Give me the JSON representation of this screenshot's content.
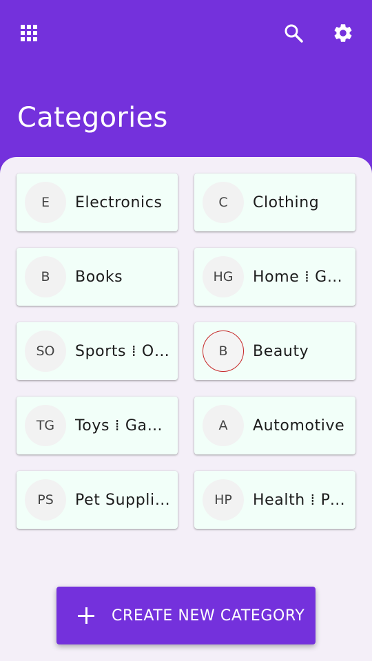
{
  "app": {
    "title": "Categories"
  },
  "toolbar": {
    "menu_icon": "apps-grid-icon",
    "search_icon": "search-icon",
    "settings_icon": "gear-icon"
  },
  "categories": [
    {
      "initials": "E",
      "name": "Electronics"
    },
    {
      "initials": "C",
      "name": "Clothing"
    },
    {
      "initials": "B",
      "name": "Books"
    },
    {
      "initials": "HG",
      "name": "Home ⁞ Ga…"
    },
    {
      "initials": "SO",
      "name": "Sports ⁞ O…"
    },
    {
      "initials": "B",
      "name": "Beauty",
      "selected": true
    },
    {
      "initials": "TG",
      "name": "Toys ⁞ Gam…"
    },
    {
      "initials": "A",
      "name": "Automotive"
    },
    {
      "initials": "PS",
      "name": "Pet Supplies"
    },
    {
      "initials": "HP",
      "name": "Health ⁞ Pe…"
    }
  ],
  "fab": {
    "label": "CREATE NEW CATEGORY",
    "icon": "plus-icon"
  },
  "colors": {
    "primary": "#7431dc",
    "card_bg": "#f2fff9",
    "sheet_bg": "#f4eff8",
    "selected_border": "#c62828"
  }
}
